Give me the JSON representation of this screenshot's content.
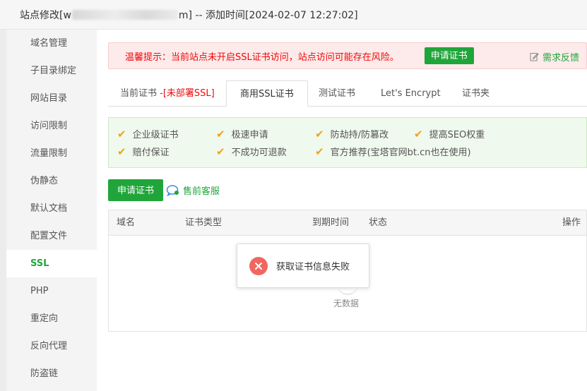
{
  "window": {
    "title_prefix": "站点修改[",
    "title_visible": "w",
    "title_suffix": "m] -- 添加时间[2024-02-07 12:27:02]"
  },
  "sidebar": {
    "items": [
      {
        "label": "域名管理"
      },
      {
        "label": "子目录绑定"
      },
      {
        "label": "网站目录"
      },
      {
        "label": "访问限制"
      },
      {
        "label": "流量限制"
      },
      {
        "label": "伪静态"
      },
      {
        "label": "默认文档"
      },
      {
        "label": "配置文件"
      },
      {
        "label": "SSL",
        "active": true
      },
      {
        "label": "PHP"
      },
      {
        "label": "重定向"
      },
      {
        "label": "反向代理"
      },
      {
        "label": "防盗链"
      }
    ]
  },
  "alert": {
    "message": "温馨提示：当前站点未开启SSL证书访问，站点访问可能存在风险。",
    "button": "申请证书",
    "feedback": "需求反馈"
  },
  "tabs": {
    "current_label": "当前证书 -",
    "current_status": "[未部署SSL]",
    "items": [
      "商用SSL证书",
      "测试证书",
      "Let's Encrypt",
      "证书夹"
    ],
    "active": "商用SSL证书"
  },
  "features": [
    "企业级证书",
    "极速申请",
    "防劫持/防篡改",
    "提高SEO权重",
    "赔付保证",
    "不成功可退款",
    "官方推荐(宝塔官网bt.cn也在使用)"
  ],
  "actions": {
    "apply": "申请证书",
    "presale": "售前客服"
  },
  "table": {
    "columns": [
      "域名",
      "证书类型",
      "到期时间",
      "状态",
      "操作"
    ],
    "empty": "无数据"
  },
  "toast": {
    "message": "获取证书信息失败"
  },
  "colors": {
    "accent": "#20a53a",
    "danger": "#ef0808",
    "check": "#f0a21a",
    "error_icon": "#f0675f"
  },
  "icons": {
    "check": "✔",
    "close": "✕"
  }
}
